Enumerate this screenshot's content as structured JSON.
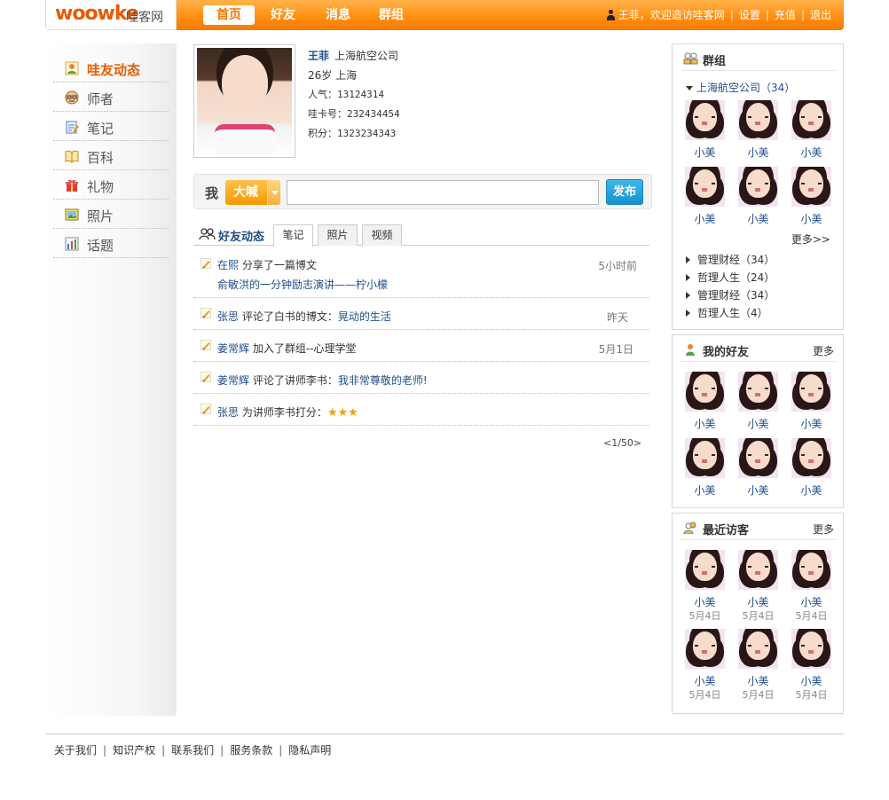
{
  "brand": {
    "logo": "woowke",
    "name": "哇客网",
    "accent": "#ff8a00"
  },
  "nav": {
    "home": "首页",
    "friends": "好友",
    "messages": "消息",
    "groups": "群组"
  },
  "user_bar": {
    "greeting": "王菲，欢迎造访哇客网",
    "settings": "设置",
    "recharge": "充值",
    "logout": "退出"
  },
  "sidebar": {
    "items": [
      {
        "label": "哇友动态",
        "icon": "friends-activity-icon",
        "active": true
      },
      {
        "label": "师者",
        "icon": "teacher-icon",
        "active": false
      },
      {
        "label": "笔记",
        "icon": "notes-icon",
        "active": false
      },
      {
        "label": "百科",
        "icon": "encyclopedia-icon",
        "active": false
      },
      {
        "label": "礼物",
        "icon": "gift-icon",
        "active": false
      },
      {
        "label": "照片",
        "icon": "photo-icon",
        "active": false
      },
      {
        "label": "话题",
        "icon": "topic-chart-icon",
        "active": false
      }
    ]
  },
  "profile": {
    "name": "王菲",
    "company": "上海航空公司",
    "age_city": "26岁 上海",
    "popularity": "人气：13124314",
    "card": "哇卡号：232434454",
    "points": "积分：1323234343"
  },
  "post_box": {
    "me": "我",
    "shout": "大喊",
    "input_value": "",
    "publish": "发布"
  },
  "tabs": {
    "main": "好友动态",
    "items": [
      "笔记",
      "照片",
      "视频"
    ]
  },
  "feed": [
    {
      "user": "在熙",
      "action": "分享了一篇博文",
      "detail": "俞敏洪的一分钟励志演讲——柠小檬",
      "time": "5小时前"
    },
    {
      "user": "张思",
      "action": "评论了白书的博文：",
      "link": "晃动的生活",
      "time": "昨天"
    },
    {
      "user": "姜常辉",
      "action": "加入了群组--心理学堂",
      "time": "5月1日"
    },
    {
      "user": "姜常辉",
      "action": "评论了讲师李书：",
      "link": "我非常尊敬的老师!",
      "time": ""
    },
    {
      "user": "张思",
      "action": "为讲师李书打分：",
      "stars": "★★★",
      "time": ""
    }
  ],
  "pager": "<1/50>",
  "groups_box": {
    "title": "群组",
    "current": "上海航空公司（34）",
    "members": [
      "小美",
      "小美",
      "小美",
      "小美",
      "小美",
      "小美"
    ],
    "more": "更多>>",
    "list": [
      "管理财经（34）",
      "哲理人生（24）",
      "管理财经（34）",
      "哲理人生（4）"
    ]
  },
  "friends_box": {
    "title": "我的好友",
    "more": "更多",
    "members": [
      "小美",
      "小美",
      "小美",
      "小美",
      "小美",
      "小美"
    ]
  },
  "visitors_box": {
    "title": "最近访客",
    "more": "更多",
    "members": [
      {
        "name": "小美",
        "date": "5月4日"
      },
      {
        "name": "小美",
        "date": "5月4日"
      },
      {
        "name": "小美",
        "date": "5月4日"
      },
      {
        "name": "小美",
        "date": "5月4日"
      },
      {
        "name": "小美",
        "date": "5月4日"
      },
      {
        "name": "小美",
        "date": "5月4日"
      }
    ]
  },
  "footer": [
    "关于我们",
    "知识产权",
    "联系我们",
    "服务条款",
    "隐私声明"
  ]
}
